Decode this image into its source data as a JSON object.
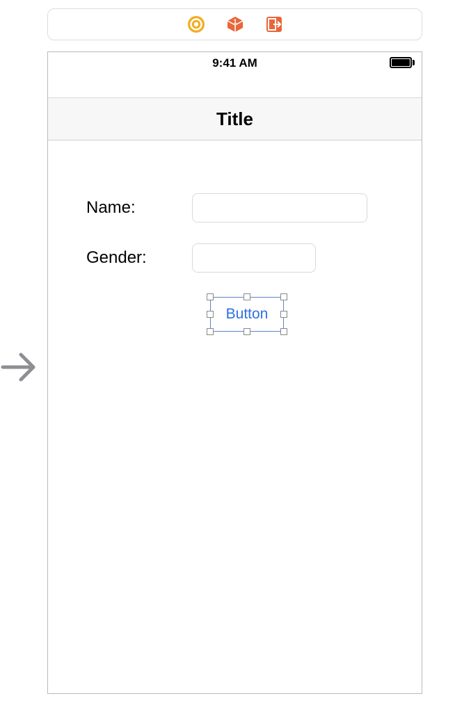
{
  "toolbar": {
    "icons": [
      "coin-icon",
      "cube-icon",
      "exit-icon"
    ]
  },
  "status": {
    "time": "9:41 AM"
  },
  "navbar": {
    "title": "Title"
  },
  "form": {
    "name_label": "Name:",
    "gender_label": "Gender:",
    "name_value": "",
    "gender_value": ""
  },
  "selected_button": {
    "label": "Button"
  },
  "colors": {
    "tint": "#2f6fe0",
    "toolbar_orange": "#e86639",
    "toolbar_yellow": "#f2ad20",
    "selection": "#5c82cc"
  }
}
